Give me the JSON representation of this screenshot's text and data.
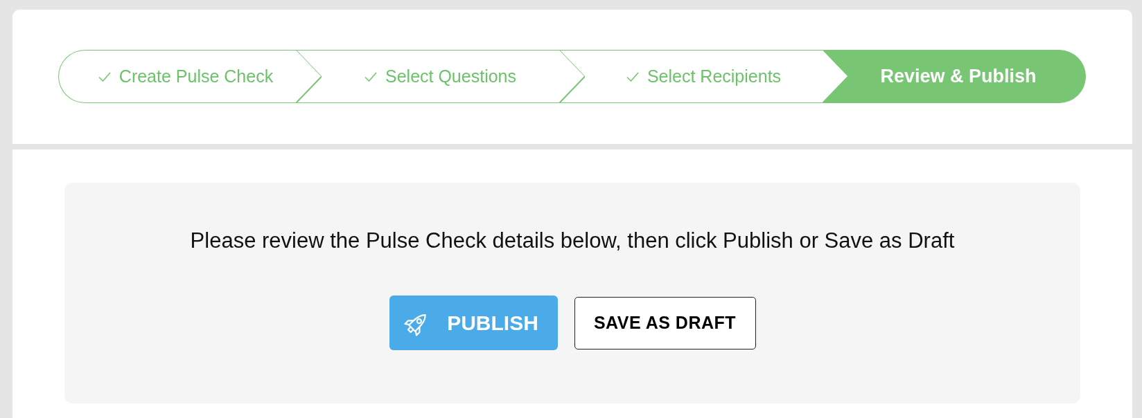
{
  "steps": [
    {
      "label": "Create Pulse Check",
      "completed": true,
      "selected": false
    },
    {
      "label": "Select Questions",
      "completed": true,
      "selected": false
    },
    {
      "label": "Select Recipients",
      "completed": true,
      "selected": false
    },
    {
      "label": "Review & Publish",
      "completed": false,
      "selected": true
    }
  ],
  "review_panel": {
    "message": "Please review the Pulse Check details below, then click Publish or Save as Draft",
    "buttons": [
      {
        "label": "PUBLISH",
        "kind": "primary"
      },
      {
        "label": "SAVE AS DRAFT",
        "kind": "outline"
      }
    ]
  }
}
